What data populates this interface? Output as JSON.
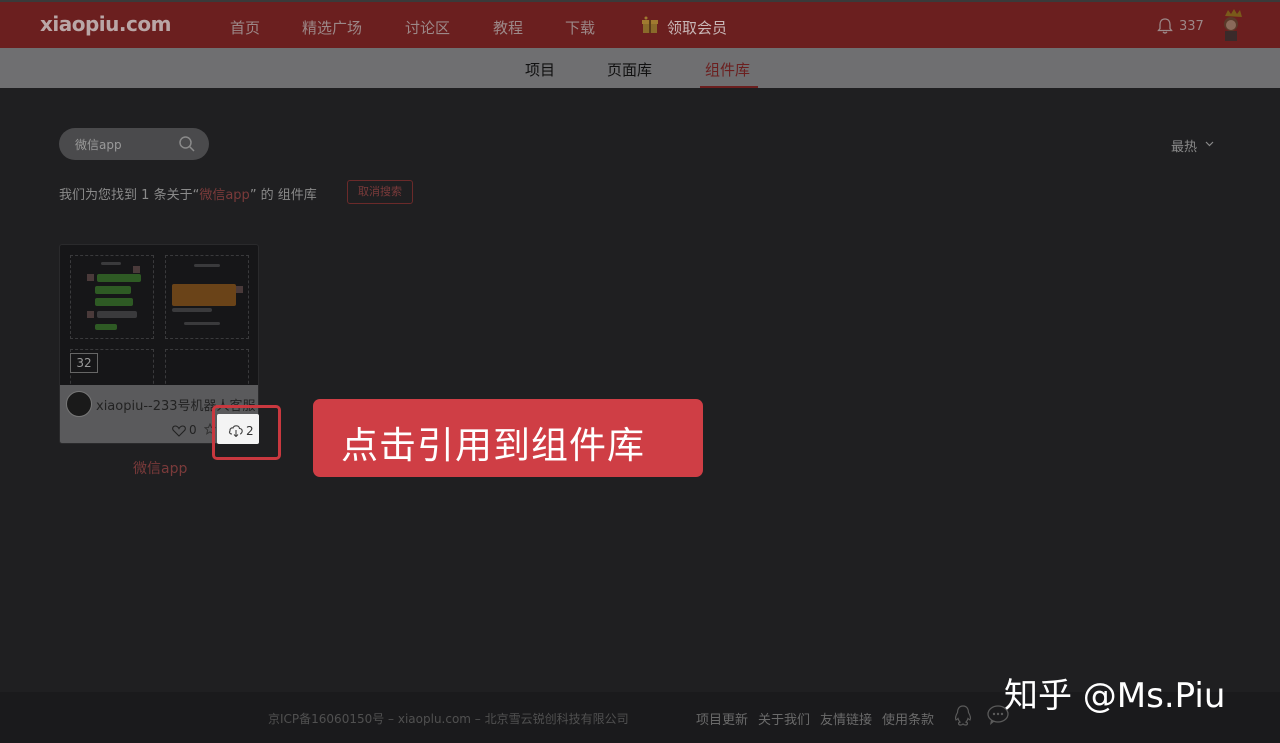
{
  "header": {
    "logo": "xiaopiu.com",
    "nav": [
      "首页",
      "精选广场",
      "讨论区",
      "教程",
      "下载"
    ],
    "vip_label": "领取会员",
    "notification_count": "337"
  },
  "subnav": {
    "tabs": [
      "项目",
      "页面库",
      "组件库"
    ],
    "active_tab": "组件库"
  },
  "search": {
    "value": "微信app",
    "sort_label": "最热"
  },
  "results": {
    "prefix": "我们为您找到",
    "count": "1",
    "mid": "条关于“",
    "keyword": "微信app",
    "suffix": "” 的 组件库",
    "cancel_label": "取消搜索"
  },
  "card": {
    "badge": "32",
    "title": "xiaopiu--233号机器人客服",
    "likes": "0",
    "downloads": "2",
    "label": "微信app"
  },
  "callout": "点击引用到组件库",
  "footer": {
    "icp": "京ICP备16060150号 – xiaoplu.com – 北京雪云锐创科技有限公司",
    "links": [
      "项目更新",
      "关于我们",
      "友情链接",
      "使用条款"
    ]
  },
  "watermark": "知乎 @Ms.Piu",
  "colors": {
    "brand": "#6b1f1f",
    "callout": "#cf3e45",
    "highlight_border": "#c9383f"
  }
}
